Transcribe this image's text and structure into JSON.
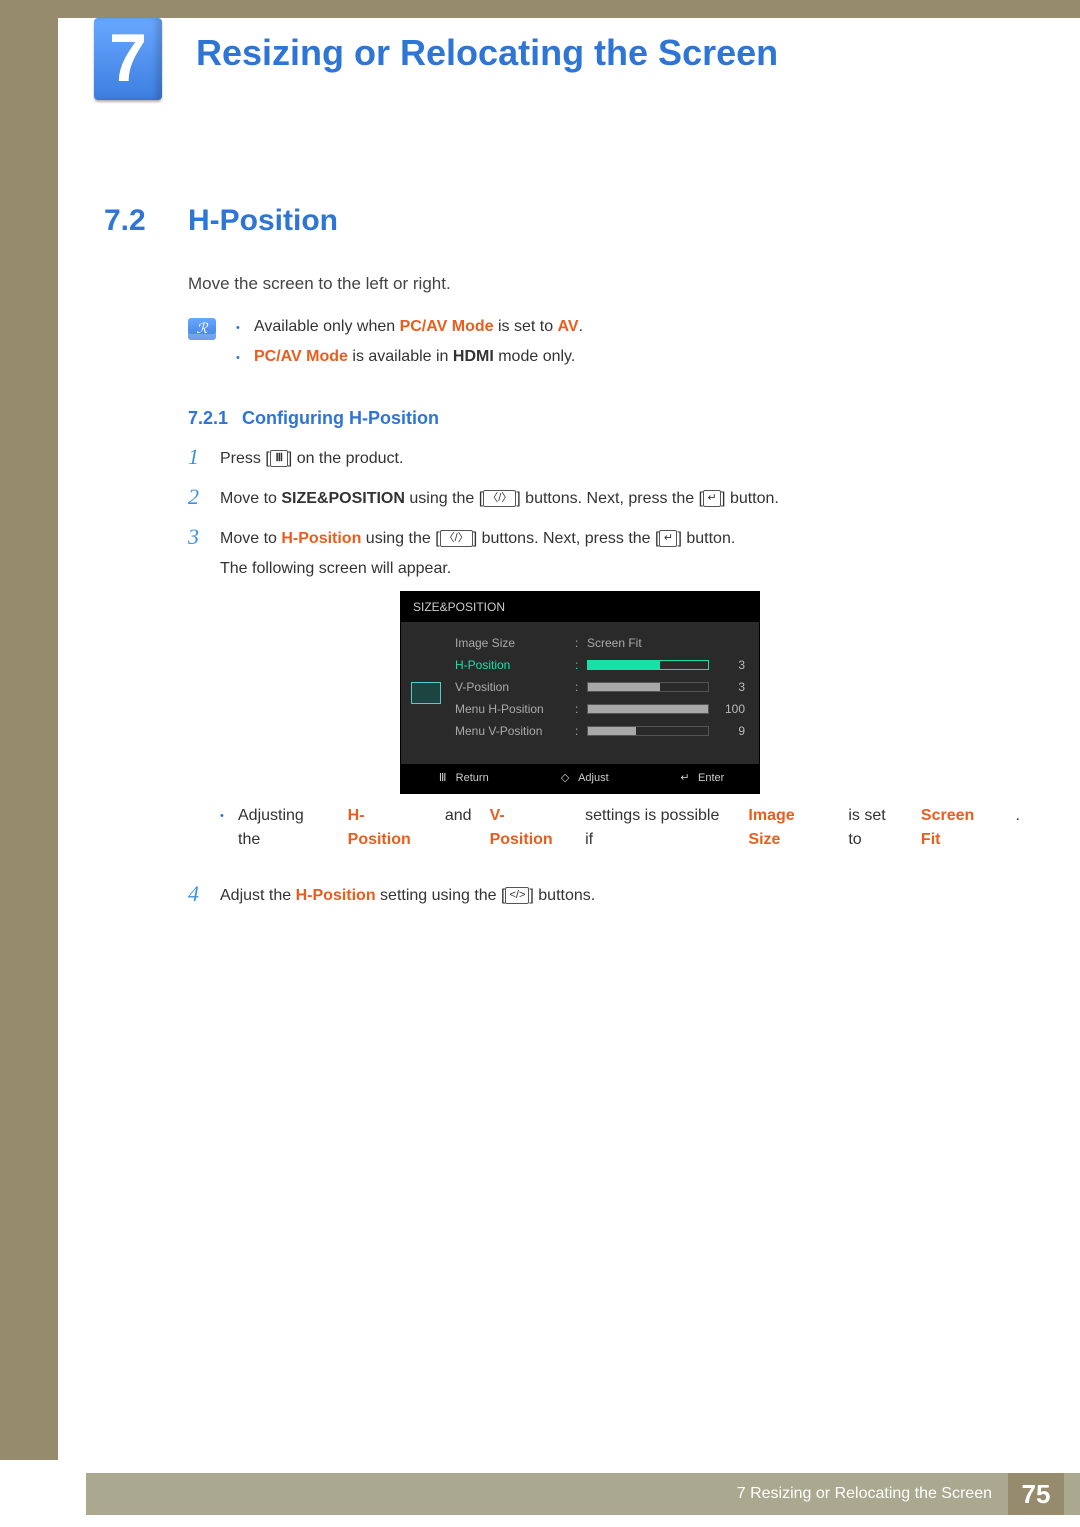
{
  "chapter": {
    "number": "7",
    "title": "Resizing or Relocating the Screen"
  },
  "section": {
    "number": "7.2",
    "title": "H-Position"
  },
  "intro": "Move the screen to the left or right.",
  "note": {
    "bullets": [
      {
        "pre": "Available only when ",
        "kw1": "PC/AV Mode",
        "mid": " is set to ",
        "kw2": "AV",
        "post": "."
      },
      {
        "kw1": "PC/AV Mode",
        "mid": " is available in ",
        "kwb": "HDMI",
        "post": " mode only."
      }
    ]
  },
  "subhead": {
    "number": "7.2.1",
    "title": "Configuring H-Position"
  },
  "steps": {
    "s1": {
      "num": "1",
      "a": "Press [",
      "b": "] on the product."
    },
    "s2": {
      "num": "2",
      "a": "Move to ",
      "kw": "SIZE&POSITION",
      "b": " using the [",
      "c": "] buttons. Next, press the [",
      "d": "] button."
    },
    "s3": {
      "num": "3",
      "a": "Move to ",
      "kw": "H-Position",
      "b": " using the [",
      "c": "] buttons. Next, press the [",
      "d": "] button.",
      "line2": "The following screen will appear."
    },
    "s3bullet": {
      "a": "Adjusting the ",
      "kw1": "H-Position",
      "b": " and ",
      "kw2": "V-Position",
      "c": " settings is possible if ",
      "kw3": "Image Size",
      "d": " is set to ",
      "kw4": "Screen Fit",
      "e": "."
    },
    "s4": {
      "num": "4",
      "a": "Adjust the ",
      "kw": "H-Position",
      "b": " setting using the [",
      "c": "] buttons."
    }
  },
  "osd": {
    "title": "SIZE&POSITION",
    "rows": [
      {
        "label": "Image Size",
        "type": "text",
        "value": "Screen Fit"
      },
      {
        "label": "H-Position",
        "type": "bar",
        "value": "3",
        "pct": 60,
        "active": true
      },
      {
        "label": "V-Position",
        "type": "bar",
        "value": "3",
        "pct": 60
      },
      {
        "label": "Menu H-Position",
        "type": "bar",
        "value": "100",
        "pct": 100
      },
      {
        "label": "Menu V-Position",
        "type": "bar",
        "value": "9",
        "pct": 40
      }
    ],
    "footer": {
      "return": "Return",
      "adjust": "Adjust",
      "enter": "Enter"
    }
  },
  "footer": {
    "text": "7 Resizing or Relocating the Screen",
    "page": "75"
  }
}
